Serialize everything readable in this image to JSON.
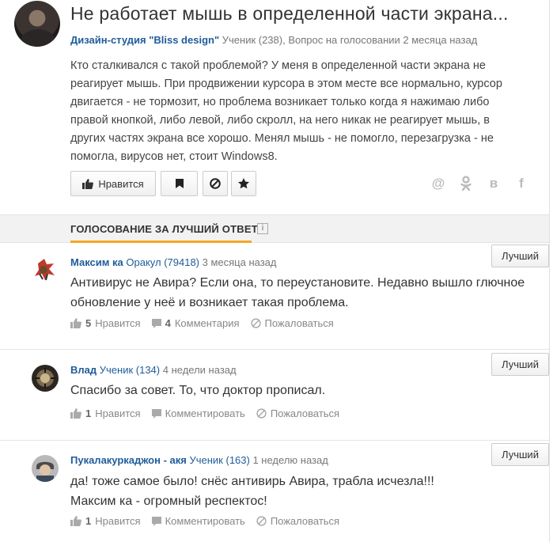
{
  "question": {
    "title": "Не работает мышь в определенной части экрана...",
    "author": "Дизайн-студия \"Bliss design\"",
    "meta": "Ученик (238), Вопрос на голосовании 2 месяца назад",
    "body": "Кто сталкивался с такой проблемой? У меня в определенной части экрана не реагирует мышь. При продвижении курсора в этом месте все нормально, курсор двигается - не тормозит, но проблема возникает только когда я нажимаю либо правой кнопкой, либо левой, либо скролл, на него никак не реагирует мышь, в других частях экрана все хорошо. Менял мышь - не помогло, перезагрузка - не помогла, вирусов нет, стоит Windows8.",
    "like_label": "Нравится",
    "share_icons": [
      "at-icon",
      "odnoklassniki-icon",
      "vk-icon",
      "facebook-icon"
    ]
  },
  "voting": {
    "title": "ГОЛОСОВАНИЕ ЗА ЛУЧШИЙ ОТВЕТ",
    "info": "i"
  },
  "answers": [
    {
      "name": "Максим ка",
      "rank": "Оракул (79418)",
      "time": "3 месяца назад",
      "text": "Антивирус не Авира? Если она, то переустановите. Недавно вышло глючное обновление у неё и возникает такая проблема.",
      "likes": "5",
      "likes_label": "Нравится",
      "comments_count": "4",
      "comments_label": "Комментария",
      "report_label": "Пожаловаться",
      "best_label": "Лучший"
    },
    {
      "name": "Влад",
      "rank": "Ученик (134)",
      "time": "4 недели назад",
      "text": "Спасибо за совет. То, что доктор прописал.",
      "likes": "1",
      "likes_label": "Нравится",
      "comments_label": "Комментировать",
      "report_label": "Пожаловаться",
      "best_label": "Лучший"
    },
    {
      "name": "Пукалакуркаджон - акя",
      "rank": "Ученик (163)",
      "time": "1 неделю назад",
      "text_line1": "да! тоже самое было! снёс антивирь Авира, трабла исчезла!!!",
      "text_line2": "Максим ка - огромный респектос!",
      "likes": "1",
      "likes_label": "Нравится",
      "comments_label": "Комментировать",
      "report_label": "Пожаловаться",
      "best_label": "Лучший"
    }
  ],
  "colors": {
    "link": "#1f5c9a",
    "accent": "#f5a623",
    "muted": "#888888"
  }
}
